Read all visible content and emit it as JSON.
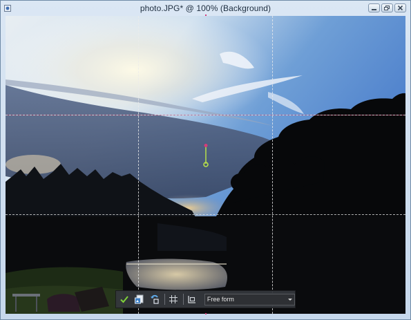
{
  "window": {
    "title": "photo.JPG* @ 100% (Background)",
    "controls": [
      "minimize-icon",
      "restore-icon",
      "close-icon"
    ]
  },
  "crop_toolbar": {
    "commit_icon": "checkmark-icon",
    "crop_as_new_icon": "crop-new-image-icon",
    "rotate_icon": "rotate-crop-icon",
    "grid_icon": "grid-icon",
    "snap_icon": "snap-to-layer-icon",
    "preset_value": "Free form"
  },
  "colors": {
    "toolbar_bg": "#34373c",
    "commit_green": "#7fd13a",
    "handle_green": "#b7e04a",
    "handle_pink": "#d43c7a"
  }
}
